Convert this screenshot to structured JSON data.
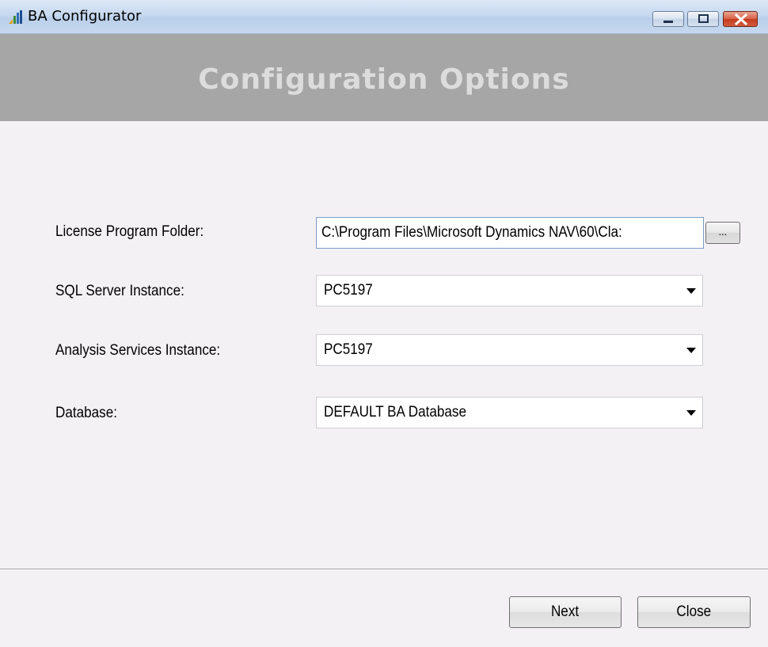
{
  "window": {
    "title": "BA Configurator",
    "icon": "bar-chart-app-icon"
  },
  "banner": {
    "title": "Configuration Options"
  },
  "form": {
    "license_program_folder": {
      "label": "License Program Folder:",
      "value": "C:\\Program Files\\Microsoft Dynamics NAV\\60\\Cla:",
      "browse_label": "..."
    },
    "sql_server_instance": {
      "label": "SQL Server Instance:",
      "value": "PC5197"
    },
    "analysis_services_instance": {
      "label": "Analysis Services Instance:",
      "value": "PC5197"
    },
    "database": {
      "label": "Database:",
      "value": "DEFAULT BA Database"
    }
  },
  "buttons": {
    "next_label": "Next",
    "close_label": "Close"
  },
  "colors": {
    "banner_bg": "#a6a6a6",
    "banner_text": "#dcdcdc",
    "window_bg": "#f4f1f5",
    "close_button": "#c43b1e"
  }
}
